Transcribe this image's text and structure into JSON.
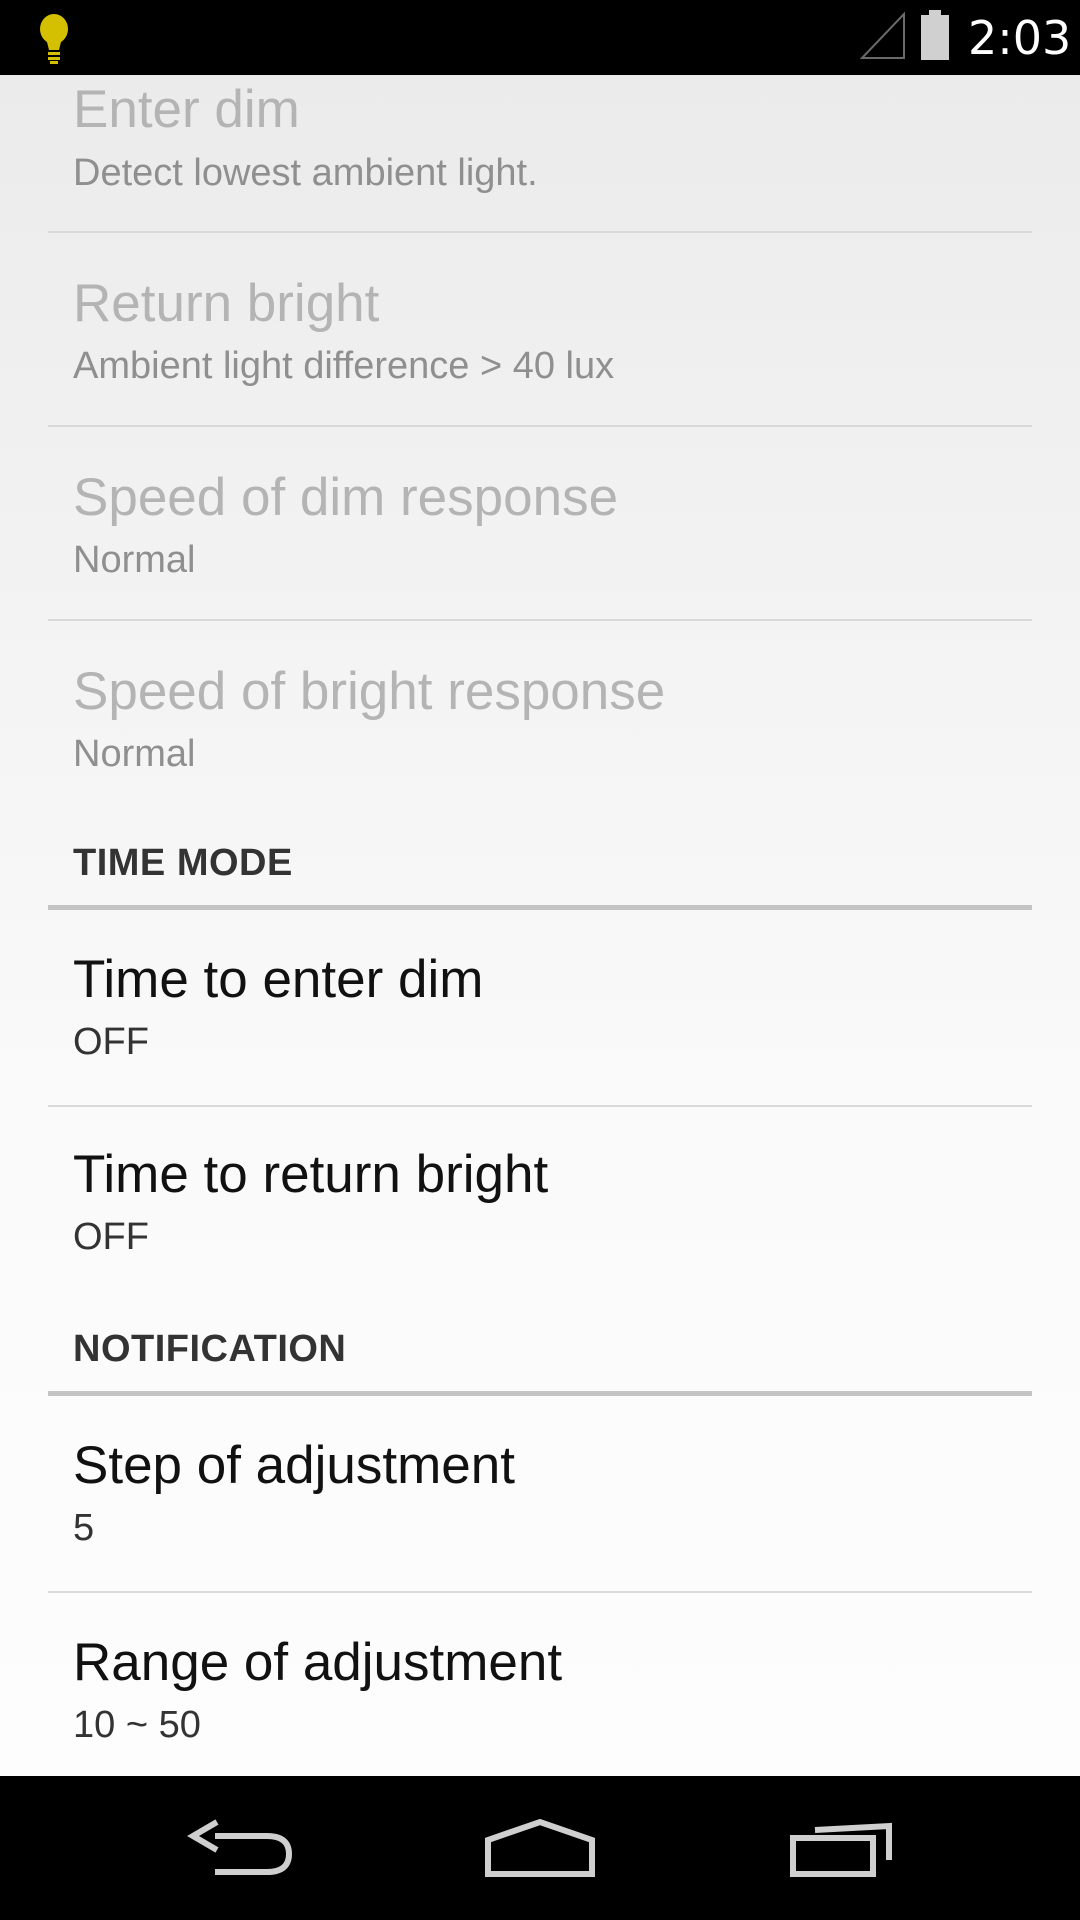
{
  "status_bar": {
    "time": "2:03",
    "icons": [
      "bulb-icon",
      "signal-icon",
      "battery-icon"
    ],
    "bulb_color": "#d4c000"
  },
  "preferences": {
    "enter_dim": {
      "title": "Enter dim",
      "summary": "Detect lowest ambient light."
    },
    "return_bright": {
      "title": "Return bright",
      "summary": "Ambient light difference > 40 lux"
    },
    "dim_speed": {
      "title": "Speed of dim response",
      "summary": "Normal"
    },
    "bright_speed": {
      "title": "Speed of bright response",
      "summary": "Normal"
    }
  },
  "time_mode": {
    "header": "TIME MODE",
    "time_to_enter_dim": {
      "title": "Time to enter dim",
      "summary": "OFF"
    },
    "time_to_return_bright": {
      "title": "Time to return bright",
      "summary": "OFF"
    }
  },
  "notification": {
    "header": "NOTIFICATION",
    "step": {
      "title": "Step of adjustment",
      "summary": "5"
    },
    "range": {
      "title": "Range of adjustment",
      "summary": "10 ~ 50"
    }
  },
  "nav_bar": {
    "buttons": [
      "back-icon",
      "home-icon",
      "recents-icon"
    ]
  }
}
